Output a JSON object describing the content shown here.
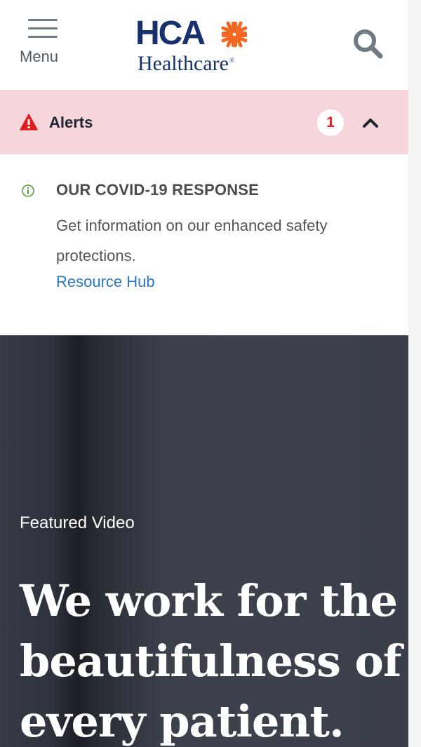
{
  "header": {
    "menu_label": "Menu",
    "logo": {
      "wordmark_top": "HCA",
      "wordmark_bottom": "Healthcare",
      "trademark": "®"
    },
    "search_icon": "magnifier-icon",
    "colors": {
      "navy": "#17306e",
      "accent": "#f26722",
      "icon_gray": "#6f7b84"
    }
  },
  "alerts": {
    "label": "Alerts",
    "count": "1",
    "state": "expanded",
    "background": "#f7d6db",
    "items": [
      {
        "title": "OUR COVID-19 RESPONSE",
        "text": "Get information on our enhanced safety protections.",
        "link_label": "Resource Hub",
        "icon": "info-icon"
      }
    ]
  },
  "hero": {
    "eyebrow": "Featured Video",
    "title": "We work for the beautifulness of every patient.",
    "background": "#3a3f49"
  }
}
